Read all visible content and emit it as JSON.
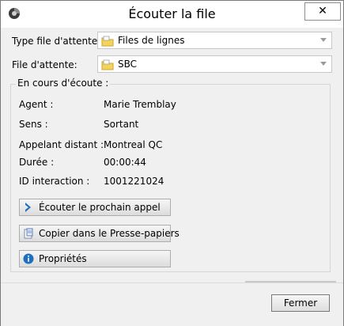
{
  "window": {
    "title": "Écouter la file",
    "close_glyph": "✕"
  },
  "queue_type": {
    "label": "Type file d'attente:",
    "value": "Files de lignes",
    "icon": "folder-queue-icon"
  },
  "queue": {
    "label": "File d'attente:",
    "value": "SBC",
    "icon": "folder-queue-icon"
  },
  "listening": {
    "group_title": "En cours d'écoute :",
    "fields": [
      {
        "label": "Agent :",
        "value": "Marie Tremblay"
      },
      {
        "label": "Sens :",
        "value": "Sortant"
      },
      {
        "label": "Appelant distant :",
        "value": "Montreal QC"
      },
      {
        "label": "Durée :",
        "value": "00:00:44"
      },
      {
        "label": "ID interaction :",
        "value": "1001221024"
      }
    ]
  },
  "actions": [
    {
      "label": "Écouter le prochain appel",
      "icon": "chevron-right-icon"
    },
    {
      "label": "Copier dans le Presse-papiers",
      "icon": "clipboard-icon"
    },
    {
      "label": "Propriétés",
      "icon": "info-icon"
    }
  ],
  "footer": {
    "close_label": "Fermer"
  },
  "colors": {
    "accent_blue": "#1e6fbf",
    "folder_yellow": "#f3d35a"
  }
}
